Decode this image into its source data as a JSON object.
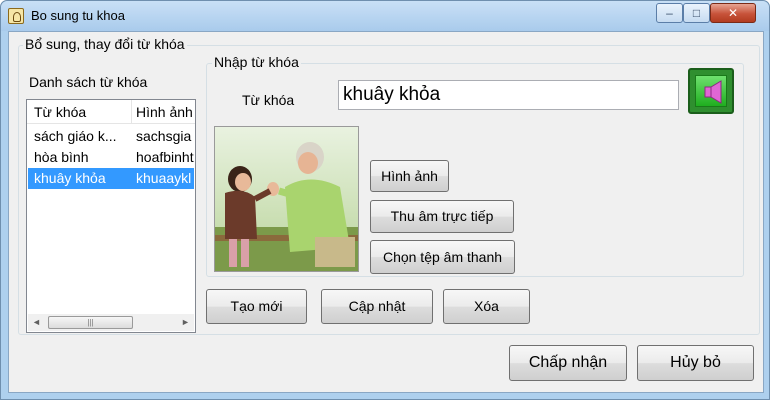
{
  "window": {
    "title": "Bo sung tu khoa",
    "min_label": "–",
    "max_label": "□",
    "close_label": "✕"
  },
  "main_group": {
    "title": "Bổ sung, thay đổi từ khóa"
  },
  "keyword_list": {
    "title": "Danh sách từ khóa",
    "columns": [
      "Từ khóa",
      "Hình ảnh"
    ],
    "rows": [
      [
        "sách giáo k...",
        "sachsgia"
      ],
      [
        "hòa bình",
        "hoafbinht"
      ],
      [
        "khuây khỏa",
        "khuaaykl"
      ]
    ],
    "selected_index": 2,
    "scroll_left": "◄",
    "scroll_right": "►",
    "scroll_thumb": "|||"
  },
  "entry_group": {
    "title": "Nhập từ khóa",
    "keyword_label": "Từ khóa",
    "keyword_value": "khuây khỏa"
  },
  "media_buttons": {
    "image": "Hình ảnh",
    "record": "Thu âm trực tiếp",
    "choose_audio": "Chọn tệp âm thanh"
  },
  "action_buttons": {
    "new": "Tạo mới",
    "update": "Cập nhật",
    "delete": "Xóa"
  },
  "dialog_buttons": {
    "accept": "Chấp nhận",
    "cancel": "Hủy bỏ"
  },
  "colors": {
    "selection": "#3399ff",
    "speaker_button": "#2f8f2f",
    "speaker_icon": "#e066d4"
  }
}
